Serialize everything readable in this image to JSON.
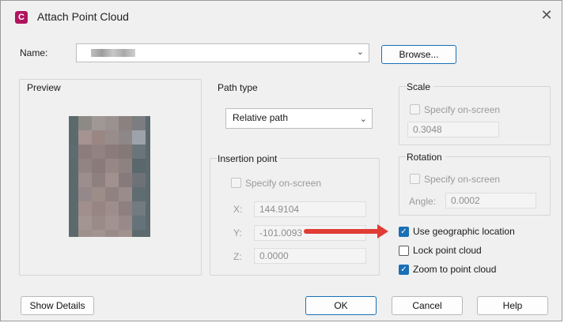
{
  "window": {
    "title": "Attach Point Cloud",
    "app_icon_letter": "C"
  },
  "name_field": {
    "label": "Name:",
    "value_blurred": true
  },
  "buttons": {
    "browse": "Browse...",
    "show_details": "Show Details",
    "ok": "OK",
    "cancel": "Cancel",
    "help": "Help"
  },
  "preview": {
    "label": "Preview"
  },
  "path_type": {
    "label": "Path type",
    "selected": "Relative path"
  },
  "insertion_point": {
    "label": "Insertion point",
    "specify_on_screen": "Specify on-screen",
    "x_label": "X:",
    "x_value": "144.9104",
    "y_label": "Y:",
    "y_value": "-101.0093",
    "z_label": "Z:",
    "z_value": "0.0000"
  },
  "scale": {
    "label": "Scale",
    "specify_on_screen": "Specify on-screen",
    "value": "0.3048"
  },
  "rotation": {
    "label": "Rotation",
    "specify_on_screen": "Specify on-screen",
    "angle_label": "Angle:",
    "angle_value": "0.0002"
  },
  "options": {
    "use_geographic": {
      "label": "Use geographic location",
      "checked": true
    },
    "lock_point_cloud": {
      "label": "Lock point cloud",
      "checked": false
    },
    "zoom_to_point_cloud": {
      "label": "Zoom to point cloud",
      "checked": true
    }
  },
  "annotation": {
    "arrow_color": "#e03c35"
  },
  "colors": {
    "accent": "#1a6fb5",
    "app_icon": "#b0145f"
  }
}
